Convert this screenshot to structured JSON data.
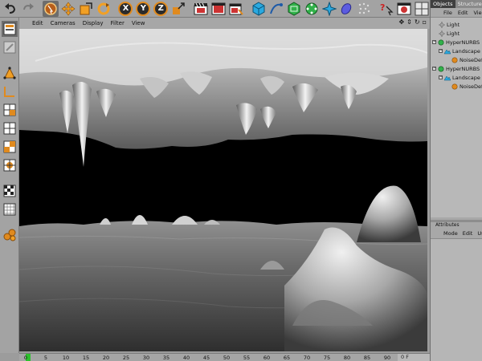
{
  "viewport_menu": {
    "items": [
      "Edit",
      "Cameras",
      "Display",
      "Filter",
      "View"
    ],
    "nav_icons": [
      "move-view-icon",
      "zoom-view-icon",
      "rotate-view-icon",
      "maximize-view-icon"
    ]
  },
  "toolbar": {
    "axes": [
      "X",
      "Y",
      "Z"
    ]
  },
  "timeline": {
    "ticks": [
      "0",
      "5",
      "10",
      "15",
      "20",
      "25",
      "30",
      "35",
      "40",
      "45",
      "50",
      "55",
      "60",
      "65",
      "70",
      "75",
      "80",
      "85",
      "90"
    ],
    "frame_value": "0 F",
    "playhead_frame": 0
  },
  "right_panel": {
    "tabs": [
      "Objects",
      "Structure"
    ],
    "menu": [
      "File",
      "Edit",
      "View"
    ],
    "tree": [
      {
        "label": "Light",
        "icon": "light-icon",
        "depth": 0,
        "expander": false
      },
      {
        "label": "Light",
        "icon": "light-icon",
        "depth": 0,
        "expander": false
      },
      {
        "label": "HyperNURBS",
        "icon": "hypernurbs-icon",
        "depth": 0,
        "expander": true
      },
      {
        "label": "Landscape",
        "icon": "landscape-icon",
        "depth": 1,
        "expander": true
      },
      {
        "label": "NoiseDefo",
        "icon": "deformer-icon",
        "depth": 2,
        "expander": false
      },
      {
        "label": "HyperNURBS",
        "icon": "hypernurbs-icon",
        "depth": 0,
        "expander": true
      },
      {
        "label": "Landscape",
        "icon": "landscape-icon",
        "depth": 1,
        "expander": true
      },
      {
        "label": "NoiseDefo",
        "icon": "deformer-icon",
        "depth": 2,
        "expander": false
      }
    ],
    "attributes_tab": "Attributes",
    "attributes_menu": [
      "Mode",
      "Edit",
      "Us"
    ]
  },
  "colors": {
    "accent_orange": "#e08a1e",
    "playhead_green": "#2ec12e",
    "viewport_bg": "#000000"
  }
}
